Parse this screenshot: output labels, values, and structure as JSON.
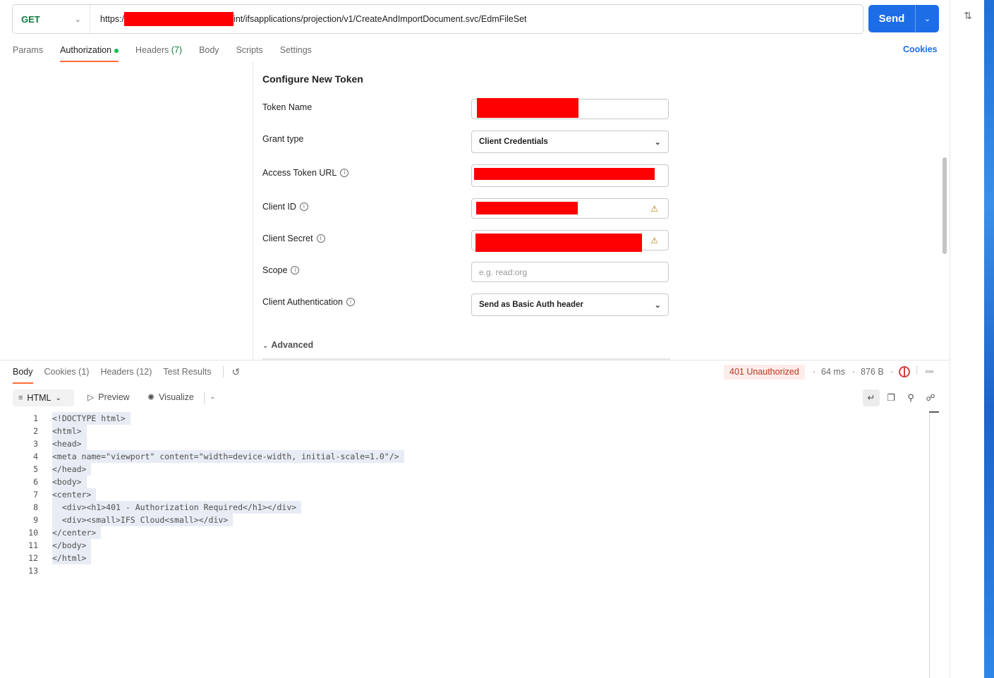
{
  "request": {
    "method": "GET",
    "url_prefix": "https:/",
    "url_suffix": "int/ifsapplications/projection/v1/CreateAndImportDocument.svc/EdmFileSet",
    "send_label": "Send"
  },
  "request_tabs": [
    {
      "label": "Params",
      "count": ""
    },
    {
      "label": "Authorization",
      "count": ""
    },
    {
      "label": "Headers",
      "count": "(7)"
    },
    {
      "label": "Body",
      "count": ""
    },
    {
      "label": "Scripts",
      "count": ""
    },
    {
      "label": "Settings",
      "count": ""
    }
  ],
  "cookies_link": "Cookies",
  "auth": {
    "title": "Configure New Token",
    "token_name_label": "Token Name",
    "grant_type_label": "Grant type",
    "grant_type_value": "Client Credentials",
    "access_token_url_label": "Access Token URL",
    "client_id_label": "Client ID",
    "client_secret_label": "Client Secret",
    "scope_label": "Scope",
    "scope_placeholder": "e.g. read:org",
    "client_auth_label": "Client Authentication",
    "client_auth_value": "Send as Basic Auth header",
    "advanced_label": "Advanced"
  },
  "response_tabs": [
    {
      "label": "Body",
      "count": ""
    },
    {
      "label": "Cookies",
      "count": "(1)"
    },
    {
      "label": "Headers",
      "count": "(12)"
    },
    {
      "label": "Test Results",
      "count": ""
    }
  ],
  "response": {
    "status": "401 Unauthorized",
    "time": "64 ms",
    "size": "876 B",
    "format": "HTML",
    "preview_label": "Preview",
    "visualize_label": "Visualize"
  },
  "code_lines": [
    "<!DOCTYPE html>",
    "<html>",
    "<head>",
    "<meta name=\"viewport\" content=\"width=device-width, initial-scale=1.0\"/>",
    "</head>",
    "<body>",
    "<center>",
    "  <div><h1>401 - Authorization Required</h1></div>",
    "  <div><small>IFS Cloud<small></div>",
    "</center>",
    "</body>",
    "</html>",
    ""
  ],
  "line_numbers": [
    "1",
    "2",
    "3",
    "4",
    "5",
    "6",
    "7",
    "8",
    "9",
    "10",
    "11",
    "12",
    "13"
  ],
  "colors": {
    "accent": "#ff6c37",
    "send": "#1d6ee6",
    "method_get": "#0f7b3f",
    "status_error": "#b5381f",
    "redaction": "#ff0000"
  }
}
